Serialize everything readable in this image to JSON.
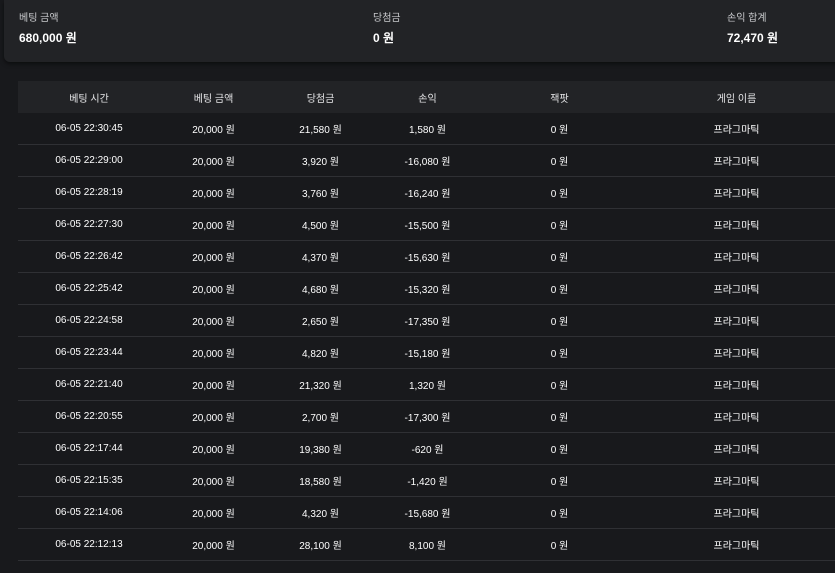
{
  "summary": {
    "bet_amount": {
      "label": "베팅 금액",
      "value": "680,000 원"
    },
    "winnings": {
      "label": "당첨금",
      "value": "0 원"
    },
    "profit_total": {
      "label": "손익 합계",
      "value": "72,470 원"
    }
  },
  "table": {
    "headers": [
      "베팅 시간",
      "베팅 금액",
      "당첨금",
      "손익",
      "잭팟",
      "게임 이름"
    ],
    "rows": [
      [
        "06-05 22:30:45",
        "20,000 원",
        "21,580 원",
        "1,580 원",
        "0 원",
        "프라그마틱"
      ],
      [
        "06-05 22:29:00",
        "20,000 원",
        "3,920 원",
        "-16,080 원",
        "0 원",
        "프라그마틱"
      ],
      [
        "06-05 22:28:19",
        "20,000 원",
        "3,760 원",
        "-16,240 원",
        "0 원",
        "프라그마틱"
      ],
      [
        "06-05 22:27:30",
        "20,000 원",
        "4,500 원",
        "-15,500 원",
        "0 원",
        "프라그마틱"
      ],
      [
        "06-05 22:26:42",
        "20,000 원",
        "4,370 원",
        "-15,630 원",
        "0 원",
        "프라그마틱"
      ],
      [
        "06-05 22:25:42",
        "20,000 원",
        "4,680 원",
        "-15,320 원",
        "0 원",
        "프라그마틱"
      ],
      [
        "06-05 22:24:58",
        "20,000 원",
        "2,650 원",
        "-17,350 원",
        "0 원",
        "프라그마틱"
      ],
      [
        "06-05 22:23:44",
        "20,000 원",
        "4,820 원",
        "-15,180 원",
        "0 원",
        "프라그마틱"
      ],
      [
        "06-05 22:21:40",
        "20,000 원",
        "21,320 원",
        "1,320 원",
        "0 원",
        "프라그마틱"
      ],
      [
        "06-05 22:20:55",
        "20,000 원",
        "2,700 원",
        "-17,300 원",
        "0 원",
        "프라그마틱"
      ],
      [
        "06-05 22:17:44",
        "20,000 원",
        "19,380 원",
        "-620 원",
        "0 원",
        "프라그마틱"
      ],
      [
        "06-05 22:15:35",
        "20,000 원",
        "18,580 원",
        "-1,420 원",
        "0 원",
        "프라그마틱"
      ],
      [
        "06-05 22:14:06",
        "20,000 원",
        "4,320 원",
        "-15,680 원",
        "0 원",
        "프라그마틱"
      ],
      [
        "06-05 22:12:13",
        "20,000 원",
        "28,100 원",
        "8,100 원",
        "0 원",
        "프라그마틱"
      ]
    ]
  }
}
